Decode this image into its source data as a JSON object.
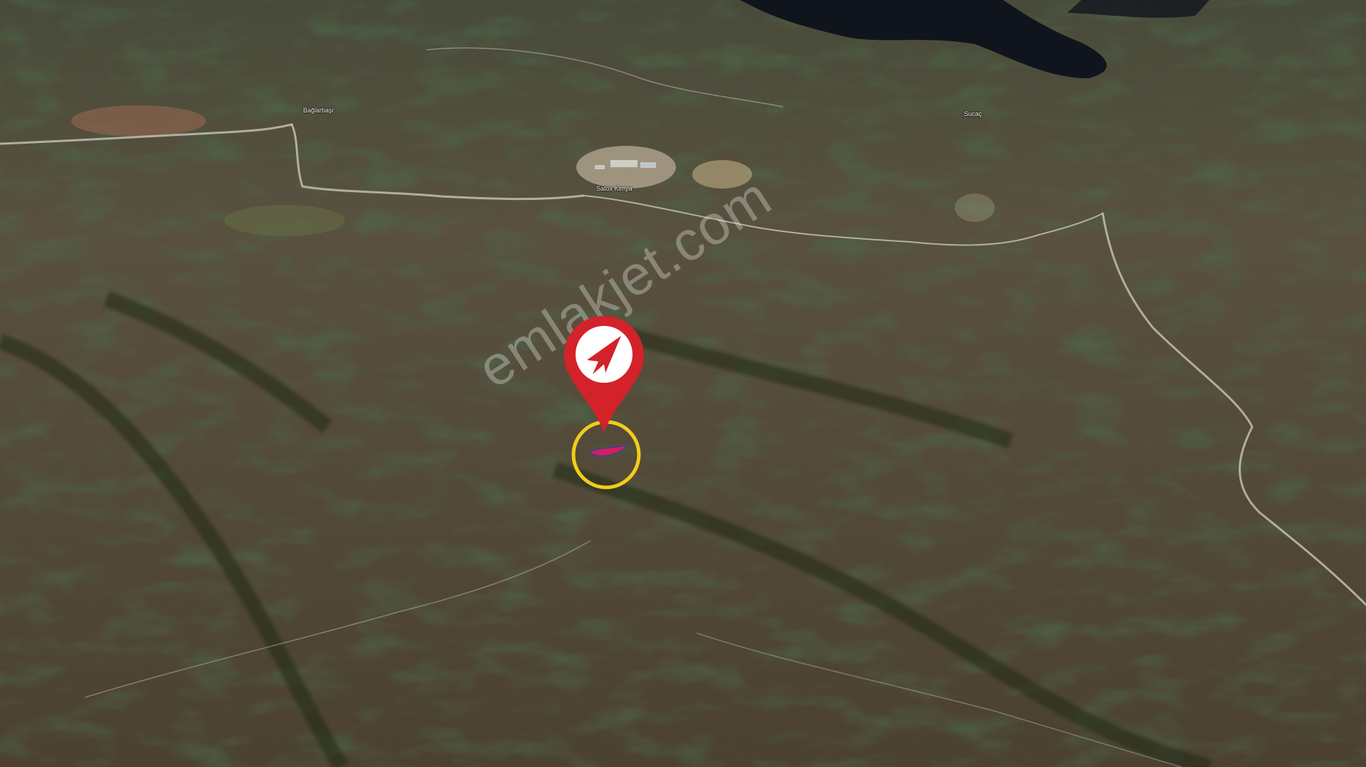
{
  "map": {
    "labels": {
      "village_1": "Bağlarbaşı",
      "village_2": "Sucaç",
      "facility": "Satox Kimya"
    },
    "watermark": "emlakjet.com",
    "marker": {
      "icon": "emlakjet-logo-pin",
      "pin_color": "#d3222a",
      "ring_color": "#f2cc1a",
      "parcel_color": "#d1205a"
    }
  }
}
